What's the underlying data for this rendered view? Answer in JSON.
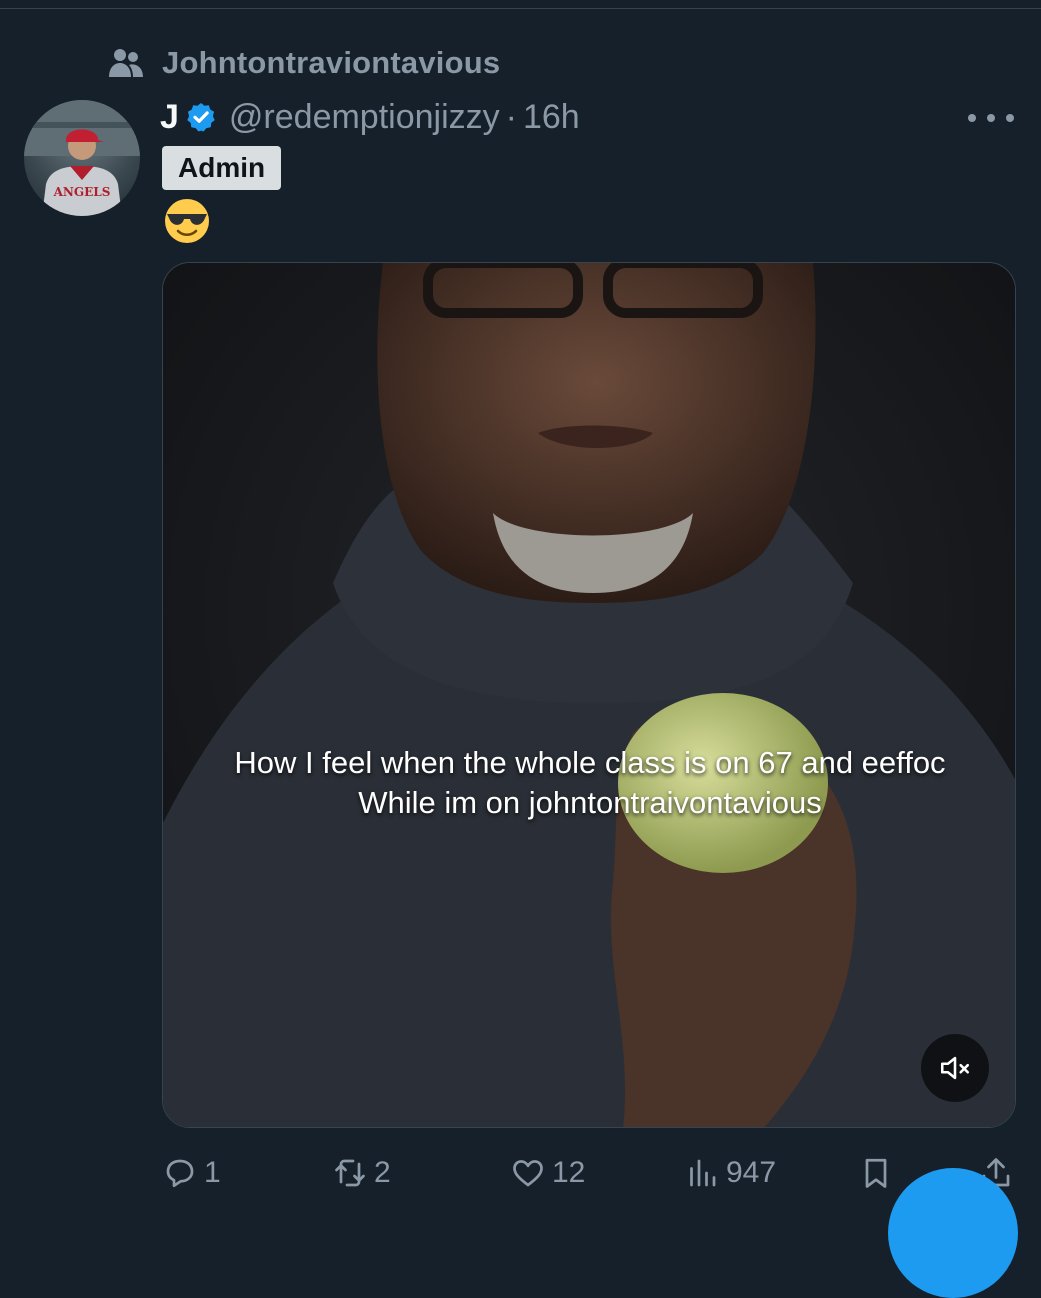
{
  "community": {
    "icon": "community-icon",
    "name": "Johntontraviontavious"
  },
  "post": {
    "author_name": "J",
    "verified": true,
    "handle": "@redemptionjizzy",
    "separator": "·",
    "time": "16h",
    "role_badge": "Admin",
    "text": "😎",
    "media": {
      "caption_line1": "How I feel when the whole class is on 67 and eeffoc",
      "caption_line2": "While im on johntontraivontavious",
      "muted": true
    }
  },
  "actions": {
    "replies": "1",
    "reposts": "2",
    "likes": "12",
    "views": "947"
  },
  "colors": {
    "background": "#15202b",
    "muted_text": "#8b98a5",
    "accent": "#1d9bf0",
    "badge_bg": "#d9dee1"
  }
}
